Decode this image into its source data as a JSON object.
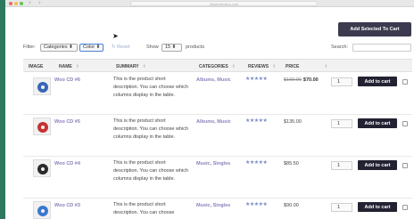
{
  "browser": {
    "address": "bitsandbrains.com"
  },
  "bulk": {
    "add_selected_label": "Add Selected To Cart"
  },
  "filters": {
    "label": "Filter:",
    "categories_value": "Categories",
    "color_value": "Color",
    "reset_label": "Reset",
    "show_label": "Show",
    "show_value": "15",
    "products_label": "products",
    "search_label": "Search:",
    "search_value": ""
  },
  "table": {
    "columns": [
      "IMAGE",
      "NAME",
      "SUMMARY",
      "CATEGORIES",
      "REVIEWS",
      "PRICE"
    ],
    "rows": [
      {
        "name": "Woo CD #6",
        "summary": "This is the product short description. You can choose which columns display in the table.",
        "categories": "Albums, Music",
        "rating": 4.5,
        "stars": "★★★★★",
        "old_price": "$100.00",
        "price": "$70.00",
        "qty": "1",
        "cart_label": "Add to cart",
        "cd_color": "#3a66b8"
      },
      {
        "name": "Woo CD #5",
        "summary": "This is the product short description. You can choose which columns display in the table.",
        "categories": "Albums, Music",
        "rating": 4.5,
        "stars": "★★★★★",
        "old_price": "",
        "price": "$135.00",
        "qty": "1",
        "cart_label": "Add to cart",
        "cd_color": "#c63232"
      },
      {
        "name": "Woo CD #4",
        "summary": "This is the product short description. You can choose which columns display in the table.",
        "categories": "Music, Singles",
        "rating": 4.5,
        "stars": "★★★★★",
        "old_price": "",
        "price": "$85.50",
        "qty": "1",
        "cart_label": "Add to cart",
        "cd_color": "#2b2b2b"
      },
      {
        "name": "Woo CD #3",
        "summary": "This is the product short description. You can choose",
        "categories": "Music, Singles",
        "rating": 4.5,
        "stars": "★★★★★",
        "old_price": "",
        "price": "$90.00",
        "qty": "1",
        "cart_label": "Add to cart",
        "cd_color": "#3a78d0"
      }
    ]
  }
}
